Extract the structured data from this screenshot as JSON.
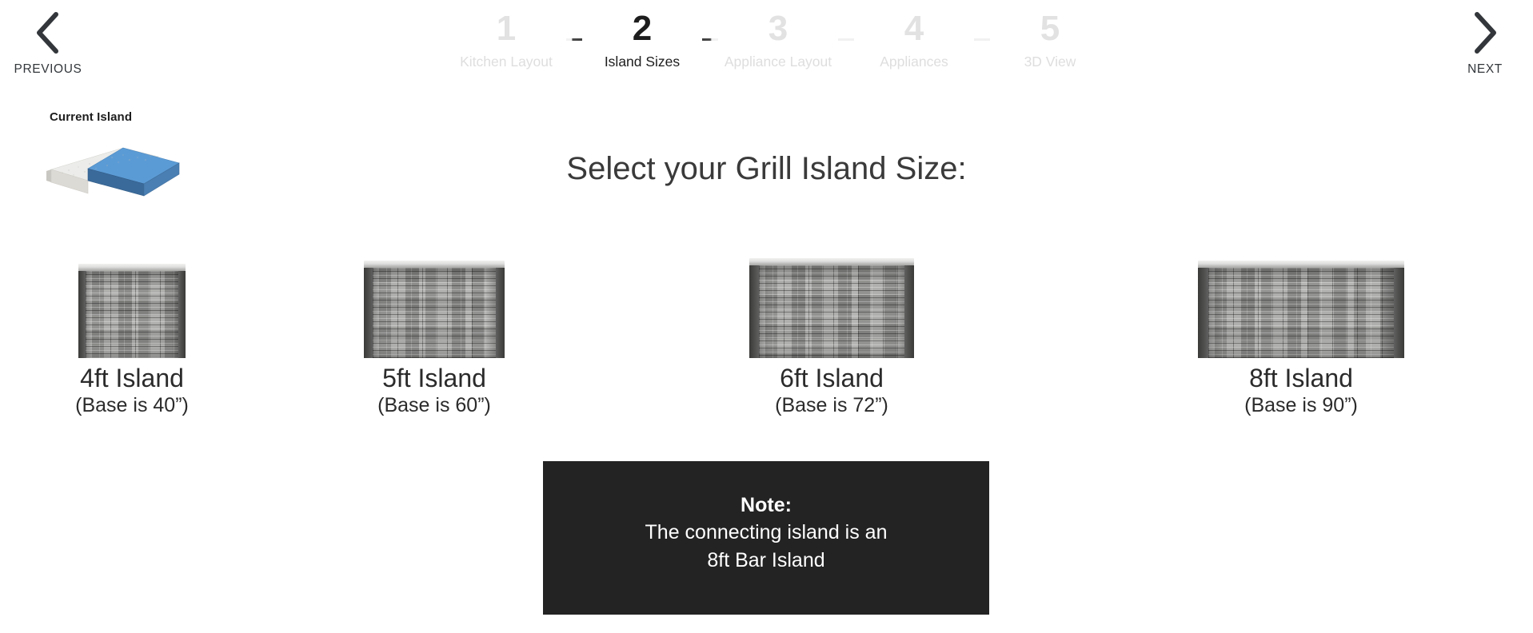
{
  "nav": {
    "previous": {
      "label": "PREVIOUS",
      "icon": "chevron-left-icon"
    },
    "next": {
      "label": "NEXT",
      "icon": "chevron-right-icon"
    }
  },
  "stepper": {
    "active_step": 2,
    "steps": [
      {
        "number": "1",
        "label": "Kitchen Layout",
        "active": false
      },
      {
        "number": "2",
        "label": "Island Sizes",
        "active": true
      },
      {
        "number": "3",
        "label": "Appliance Layout",
        "active": false
      },
      {
        "number": "4",
        "label": "Appliances",
        "active": false
      },
      {
        "number": "5",
        "label": "3D View",
        "active": false
      }
    ]
  },
  "current_island": {
    "label": "Current Island",
    "shape": "l-shaped-island",
    "colors": {
      "leg_a_top": "#eeeeec",
      "leg_a_front": "#d9d7d1",
      "leg_b_top": "#5b9bd5",
      "leg_b_front": "#3a6a9a"
    }
  },
  "main": {
    "title": "Select your Grill Island Size:"
  },
  "options": [
    {
      "name": "4ft Island",
      "sub": "(Base is 40”)",
      "art": "stone-island-4ft"
    },
    {
      "name": "5ft Island",
      "sub": "(Base is 60”)",
      "art": "stone-island-5ft"
    },
    {
      "name": "6ft Island",
      "sub": "(Base is 72”)",
      "art": "stone-island-6ft"
    },
    {
      "name": "8ft Island",
      "sub": "(Base is 90”)",
      "art": "stone-island-8ft"
    }
  ],
  "note": {
    "title": "Note:",
    "line1": "The connecting island is an",
    "line2": "8ft Bar Island",
    "background": "#232323",
    "text_color": "#ffffff"
  },
  "colors": {
    "page_background": "#ffffff",
    "active_step": "#1d1d1d",
    "inactive_step": "#e0e0e0",
    "title": "#3a3a3a",
    "stone_base": "#9d9d9b",
    "counter_top": "#dedede"
  }
}
